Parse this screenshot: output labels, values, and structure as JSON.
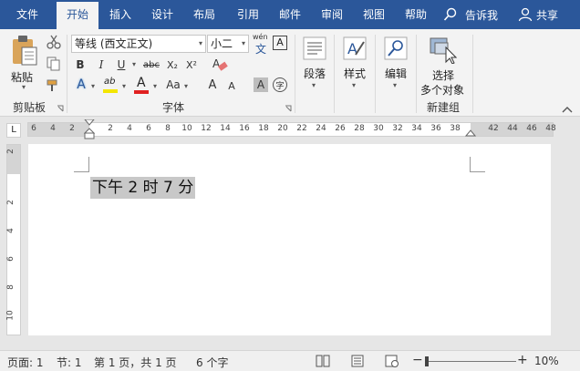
{
  "tabs": [
    "文件",
    "开始",
    "插入",
    "设计",
    "布局",
    "引用",
    "邮件",
    "审阅",
    "视图",
    "帮助"
  ],
  "tell_me": "告诉我",
  "share": "共享",
  "clipboard": {
    "paste": "粘贴",
    "group": "剪贴板"
  },
  "font": {
    "family": "等线 (西文正文)",
    "size": "小二",
    "wen_top": "wén",
    "wen_bottom": "文",
    "boxA": "A",
    "bold": "B",
    "italic": "I",
    "underline": "U",
    "strike": "abc",
    "sub": "X₂",
    "sup": "X²",
    "effect": "A",
    "highlight": "ab",
    "color": "A",
    "case": "Aa",
    "grow": "A",
    "shrink": "A",
    "char_shade": "A",
    "enclose": "字",
    "group": "字体"
  },
  "paragraph": {
    "label": "段落"
  },
  "styles": {
    "label": "样式"
  },
  "editing": {
    "label": "编辑"
  },
  "newgroup": {
    "line1": "选择",
    "line2": "多个对象",
    "group": "新建组"
  },
  "ruler": {
    "ticks": [
      "6",
      "4",
      "2",
      "2",
      "4",
      "6",
      "8",
      "10",
      "12",
      "14",
      "16",
      "18",
      "20",
      "22",
      "24",
      "26",
      "28",
      "30",
      "32",
      "34",
      "36",
      "38",
      "42",
      "44",
      "46",
      "48"
    ],
    "vticks": [
      "2",
      "2",
      "4",
      "6",
      "8",
      "10"
    ],
    "corner": "L"
  },
  "document": {
    "text": "下午 2 时 7 分"
  },
  "status": {
    "page": "页面: 1",
    "section": "节: 1",
    "pages": "第 1 页，共 1 页",
    "words": "6 个字",
    "zoom_minus": "−",
    "zoom_plus": "+",
    "zoom": "10%"
  },
  "colors": {
    "accent": "#2b579a",
    "highlight": "#f3e600",
    "fontcolor": "#e02020",
    "selection": "#c8c8c8"
  }
}
